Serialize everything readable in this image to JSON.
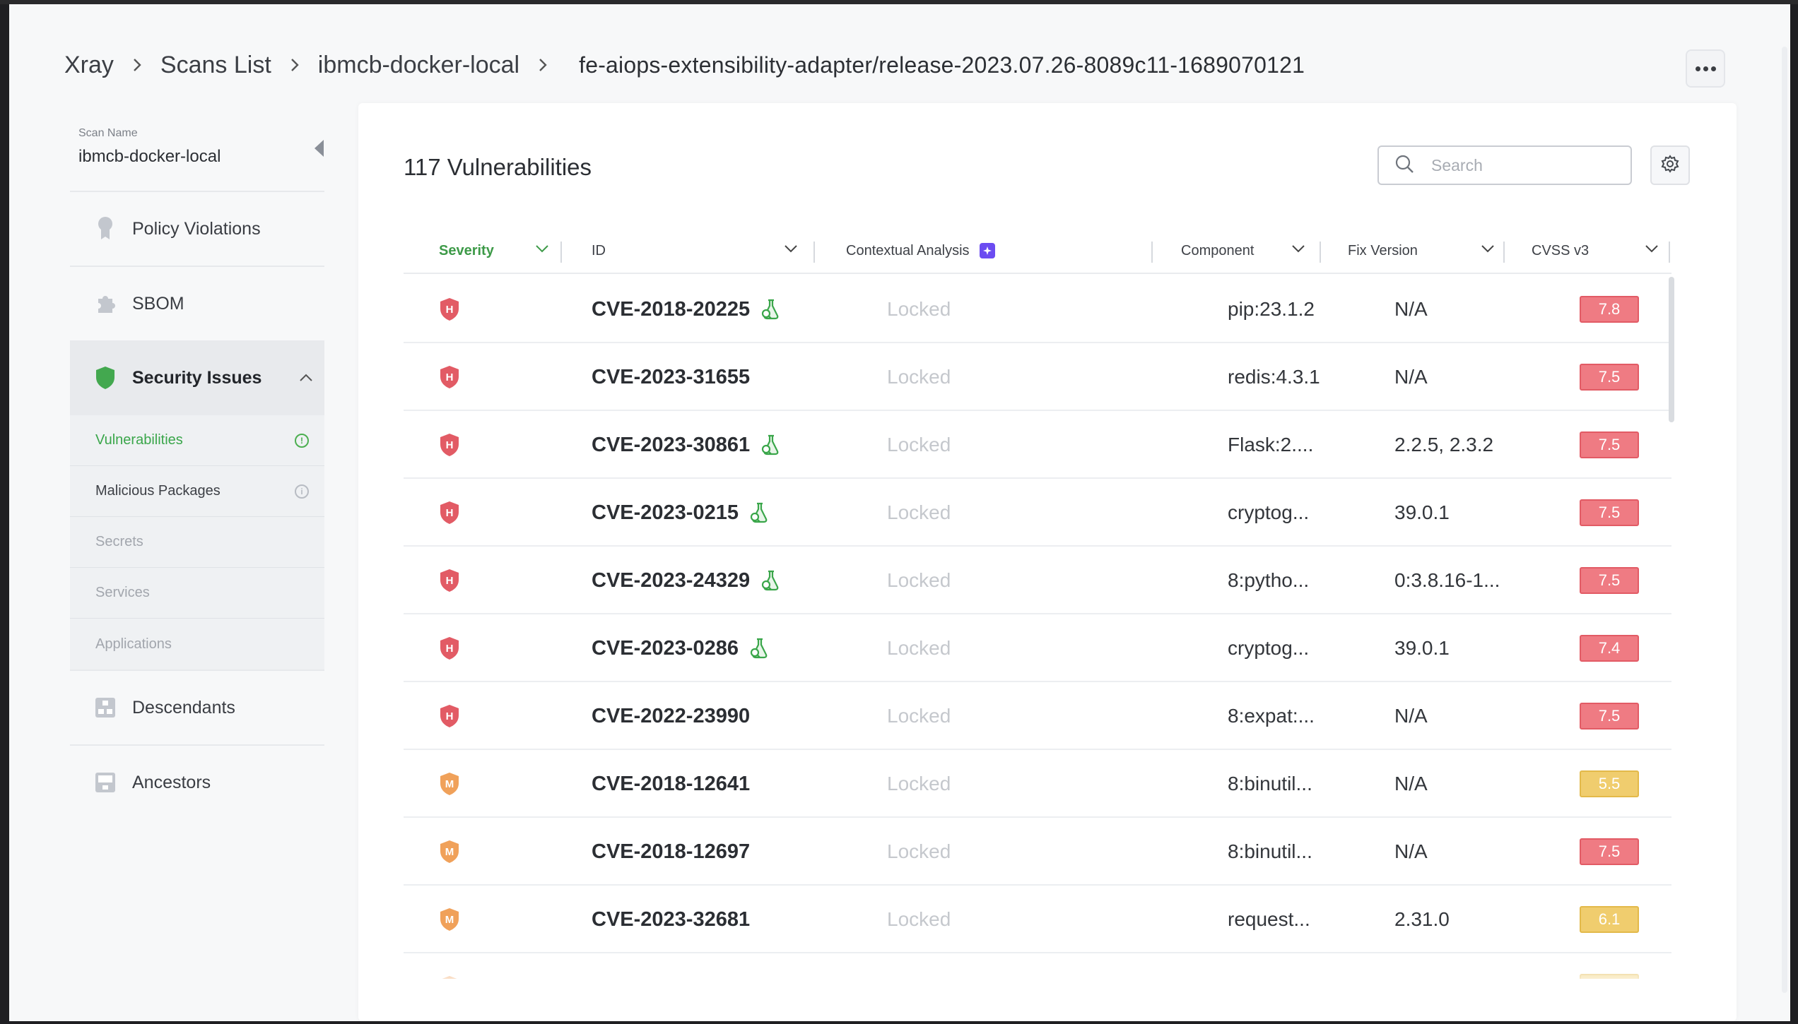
{
  "breadcrumb": {
    "items": [
      "Xray",
      "Scans List",
      "ibmcb-docker-local"
    ],
    "current": "fe-aiops-extensibility-adapter/release-2023.07.26-8089c11-1689070121"
  },
  "sidebar": {
    "scan_label": "Scan Name",
    "scan_name": "ibmcb-docker-local",
    "items": [
      {
        "label": "Policy Violations",
        "icon": "award-icon"
      },
      {
        "label": "SBOM",
        "icon": "puzzle-icon"
      },
      {
        "label": "Security Issues",
        "icon": "shield-icon"
      },
      {
        "label": "Descendants",
        "icon": "descendants-icon"
      },
      {
        "label": "Ancestors",
        "icon": "ancestors-icon"
      }
    ],
    "sub_items": [
      {
        "label": "Vulnerabilities",
        "state": "active"
      },
      {
        "label": "Malicious Packages",
        "state": "normal"
      },
      {
        "label": "Secrets",
        "state": "disabled"
      },
      {
        "label": "Services",
        "state": "disabled"
      },
      {
        "label": "Applications",
        "state": "disabled"
      }
    ]
  },
  "main": {
    "title": "117 Vulnerabilities",
    "search_placeholder": "Search",
    "columns": [
      "Severity",
      "ID",
      "Contextual Analysis",
      "Component",
      "Fix Version",
      "CVSS v3"
    ]
  },
  "rows": [
    {
      "severity": "H",
      "id": "CVE-2018-20225",
      "research": true,
      "ca": "Locked",
      "component": "pip:23.1.2",
      "fix": "N/A",
      "cvss": "7.8",
      "cvss_level": "high"
    },
    {
      "severity": "H",
      "id": "CVE-2023-31655",
      "research": false,
      "ca": "Locked",
      "component": "redis:4.3.1",
      "fix": "N/A",
      "cvss": "7.5",
      "cvss_level": "high"
    },
    {
      "severity": "H",
      "id": "CVE-2023-30861",
      "research": true,
      "ca": "Locked",
      "component": "Flask:2....",
      "fix": "2.2.5, 2.3.2",
      "cvss": "7.5",
      "cvss_level": "high"
    },
    {
      "severity": "H",
      "id": "CVE-2023-0215",
      "research": true,
      "ca": "Locked",
      "component": "cryptog...",
      "fix": "39.0.1",
      "cvss": "7.5",
      "cvss_level": "high"
    },
    {
      "severity": "H",
      "id": "CVE-2023-24329",
      "research": true,
      "ca": "Locked",
      "component": "8:pytho...",
      "fix": "0:3.8.16-1...",
      "cvss": "7.5",
      "cvss_level": "high"
    },
    {
      "severity": "H",
      "id": "CVE-2023-0286",
      "research": true,
      "ca": "Locked",
      "component": "cryptog...",
      "fix": "39.0.1",
      "cvss": "7.4",
      "cvss_level": "high"
    },
    {
      "severity": "H",
      "id": "CVE-2022-23990",
      "research": false,
      "ca": "Locked",
      "component": "8:expat:...",
      "fix": "N/A",
      "cvss": "7.5",
      "cvss_level": "high"
    },
    {
      "severity": "M",
      "id": "CVE-2018-12641",
      "research": false,
      "ca": "Locked",
      "component": "8:binutil...",
      "fix": "N/A",
      "cvss": "5.5",
      "cvss_level": "medium"
    },
    {
      "severity": "M",
      "id": "CVE-2018-12697",
      "research": false,
      "ca": "Locked",
      "component": "8:binutil...",
      "fix": "N/A",
      "cvss": "7.5",
      "cvss_level": "high"
    },
    {
      "severity": "M",
      "id": "CVE-2023-32681",
      "research": false,
      "ca": "Locked",
      "component": "request...",
      "fix": "2.31.0",
      "cvss": "6.1",
      "cvss_level": "medium"
    },
    {
      "severity": "M",
      "id": "",
      "research": false,
      "ca": "",
      "component": "",
      "fix": "",
      "cvss": "",
      "cvss_level": "medium"
    }
  ],
  "colors": {
    "accent_green": "#3d9a48",
    "high": "#e25b65",
    "medium": "#f0a15a",
    "contextual_badge": "#6b4cf1"
  }
}
